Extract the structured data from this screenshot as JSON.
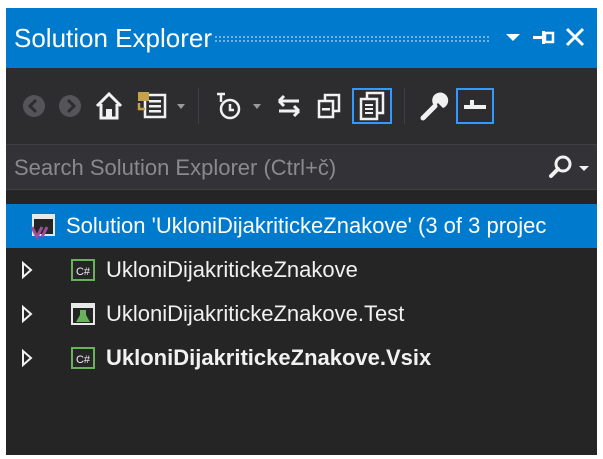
{
  "window": {
    "title": "Solution Explorer",
    "controls": {
      "menu": "▼",
      "pin": "⊣",
      "close": "✕"
    }
  },
  "toolbar": {
    "buttons": [
      {
        "name": "back-icon",
        "enabled": false
      },
      {
        "name": "forward-icon",
        "enabled": false
      },
      {
        "name": "home-icon",
        "enabled": true
      },
      {
        "name": "switch-views-icon",
        "enabled": true,
        "dropdown": true
      },
      {
        "name": "pending-changes-filter-icon",
        "enabled": true,
        "dropdown": true
      },
      {
        "name": "sync-with-active-document-icon",
        "enabled": true
      },
      {
        "name": "collapse-all-icon",
        "enabled": true
      },
      {
        "name": "show-all-files-icon",
        "enabled": true,
        "active": true
      },
      {
        "name": "properties-wrench-icon",
        "enabled": true
      },
      {
        "name": "preview-selected-items-icon",
        "enabled": true,
        "active": true
      }
    ]
  },
  "search": {
    "placeholder": "Search Solution Explorer (Ctrl+č)",
    "value": ""
  },
  "tree": {
    "solution": {
      "label": "Solution 'UkloniDijakritickeZnakove' (3 of 3 projec",
      "selected": true,
      "icon": "visual-studio-solution-icon"
    },
    "projects": [
      {
        "label": "UkloniDijakritickeZnakove",
        "icon": "csharp-project-icon",
        "bold": false,
        "expanded": false
      },
      {
        "label": "UkloniDijakritickeZnakove.Test",
        "icon": "test-project-icon",
        "bold": false,
        "expanded": false
      },
      {
        "label": "UkloniDijakritickeZnakove.Vsix",
        "icon": "csharp-project-icon",
        "bold": true,
        "expanded": false
      }
    ]
  },
  "colors": {
    "accent": "#007acc",
    "panel_bg": "#252526",
    "toolbar_bg": "#2d2d30",
    "search_bg": "#333337",
    "text": "#f1f1f1",
    "csharp_green": "#68b25c",
    "vs_purple": "#9b4f96"
  }
}
